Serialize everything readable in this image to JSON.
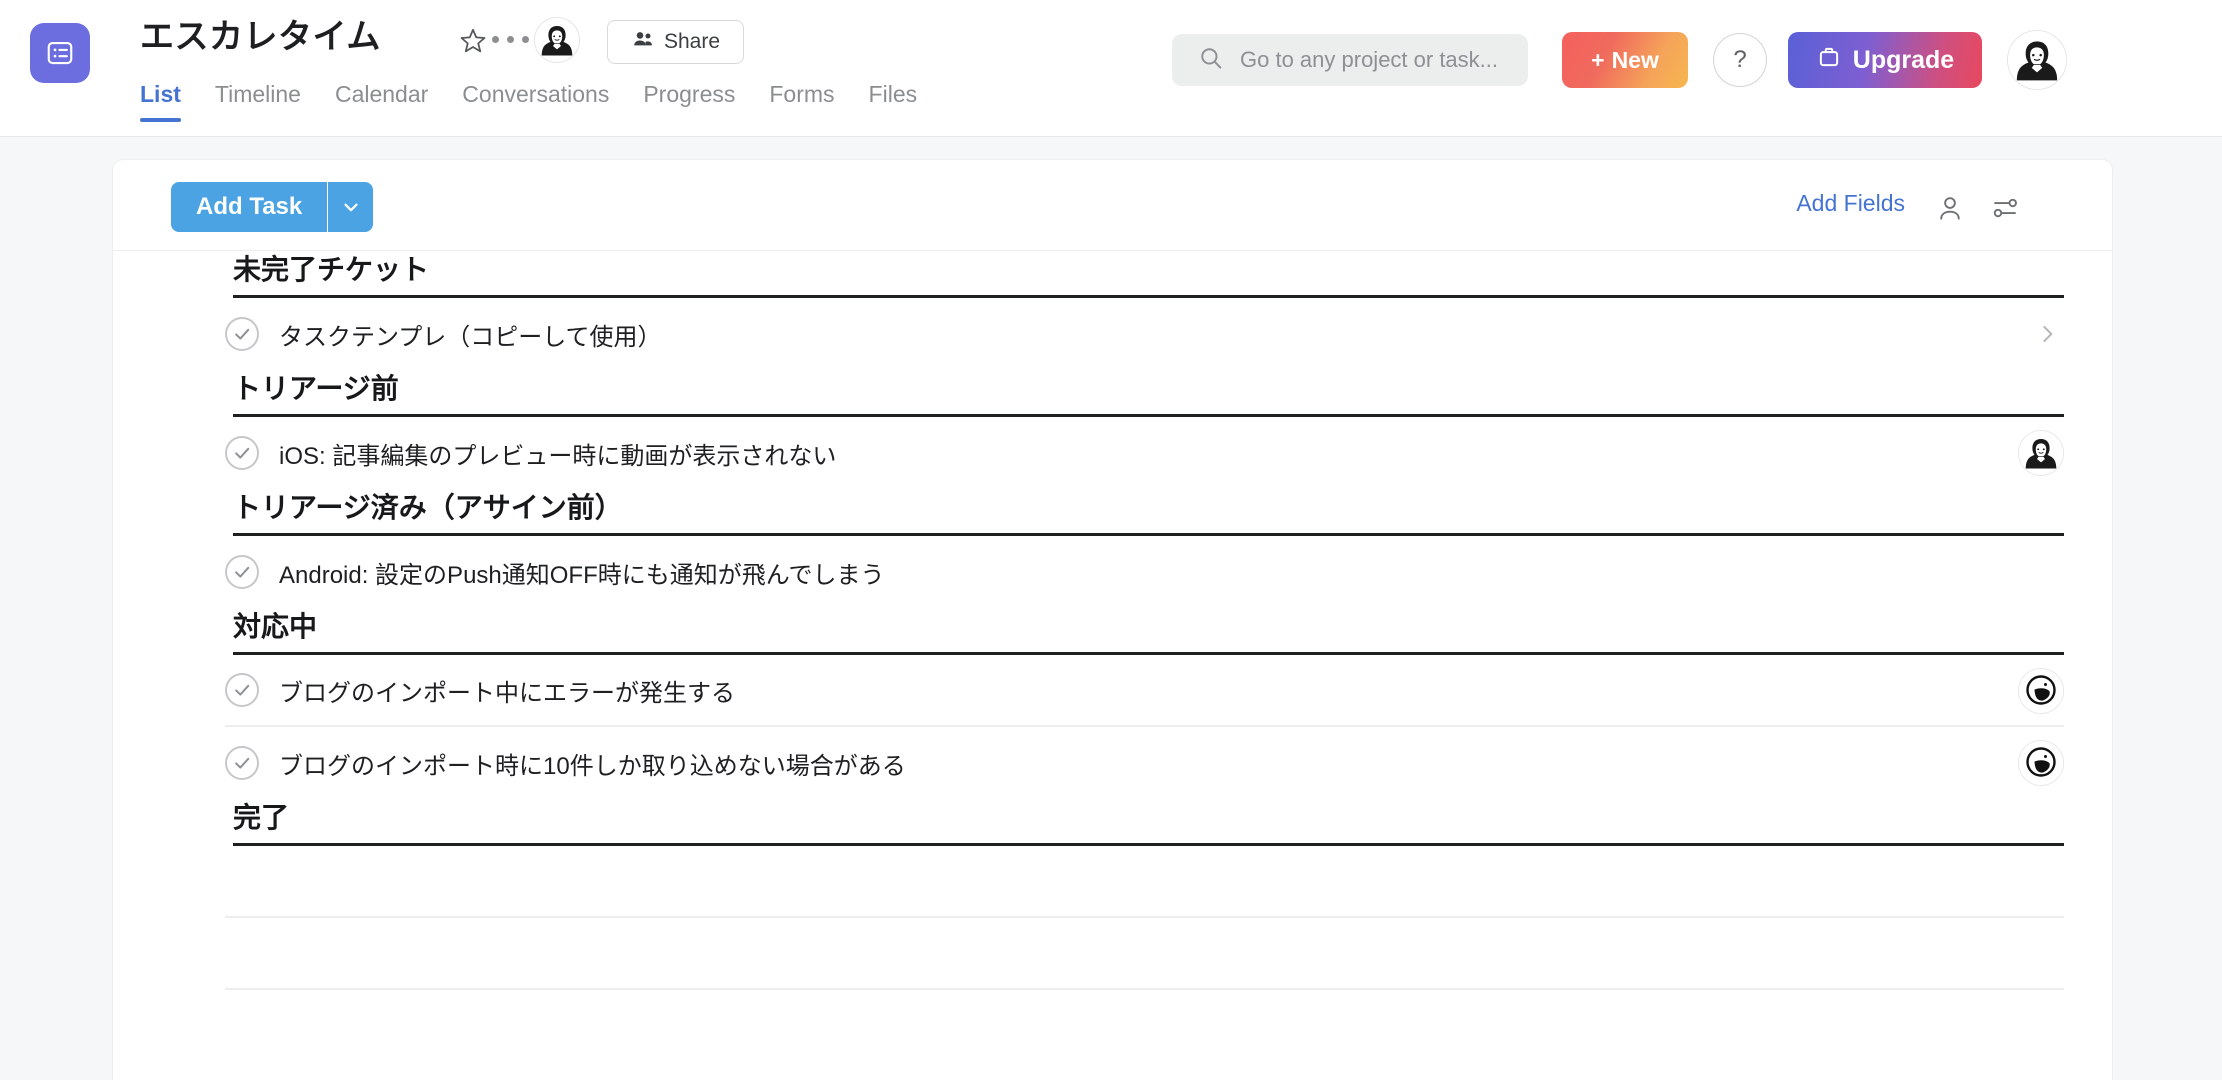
{
  "app": {
    "logo_icon": "list-logo-icon"
  },
  "header": {
    "project_title": "エスカレタイム",
    "star_icon": "star-icon",
    "more_icon": "more-options-icon",
    "owner_avatar": "owner-avatar",
    "share_label": "Share",
    "share_icon": "people-icon",
    "tabs": [
      {
        "label": "List",
        "active": true
      },
      {
        "label": "Timeline",
        "active": false
      },
      {
        "label": "Calendar",
        "active": false
      },
      {
        "label": "Conversations",
        "active": false
      },
      {
        "label": "Progress",
        "active": false
      },
      {
        "label": "Forms",
        "active": false
      },
      {
        "label": "Files",
        "active": false
      }
    ],
    "search": {
      "placeholder": "Go to any project or task...",
      "value": "",
      "icon": "search-icon"
    },
    "new_button": {
      "label": "New",
      "plus": "+"
    },
    "help_button": {
      "label": "?"
    },
    "upgrade_button": {
      "label": "Upgrade",
      "icon": "briefcase-icon"
    },
    "account_avatar": "account-avatar"
  },
  "toolbar": {
    "add_task_label": "Add Task",
    "add_task_caret_icon": "chevron-down-icon",
    "add_fields_label": "Add Fields",
    "person_icon": "person-icon",
    "filter_icon": "sort-filter-icon"
  },
  "colors": {
    "accent_blue": "#4573d2",
    "button_blue": "#4ba3e3",
    "logo_purple": "#6c6ee0",
    "page_bg": "#f6f7f8",
    "card_bg": "#ffffff",
    "section_rule": "#1e1f21",
    "row_rule": "#ededee"
  },
  "list": {
    "sections": [
      {
        "title": "未完了チケット",
        "tasks": [
          {
            "name": "タスクテンプレ（コピーして使用）",
            "check_icon": "check-circle-icon",
            "assignee_avatar": null,
            "chevron": "chevron-right-icon"
          }
        ]
      },
      {
        "title": "トリアージ前",
        "tasks": [
          {
            "name": "iOS: 記事編集のプレビュー時に動画が表示されない",
            "check_icon": "check-circle-icon",
            "assignee_avatar": "assignee-avatar-person",
            "chevron": null
          }
        ]
      },
      {
        "title": "トリアージ済み（アサイン前）",
        "tasks": [
          {
            "name": "Android: 設定のPush通知OFF時にも通知が飛んでしまう",
            "check_icon": "check-circle-icon",
            "assignee_avatar": null,
            "chevron": null
          }
        ]
      },
      {
        "title": "対応中",
        "tasks": [
          {
            "name": "ブログのインポート中にエラーが発生する",
            "check_icon": "check-circle-icon",
            "assignee_avatar": "assignee-avatar-abstract",
            "chevron": null
          },
          {
            "name": "ブログのインポート時に10件しか取り込めない場合がある",
            "check_icon": "check-circle-icon",
            "assignee_avatar": "assignee-avatar-abstract",
            "chevron": null
          }
        ]
      },
      {
        "title": "完了",
        "tasks": []
      }
    ]
  }
}
